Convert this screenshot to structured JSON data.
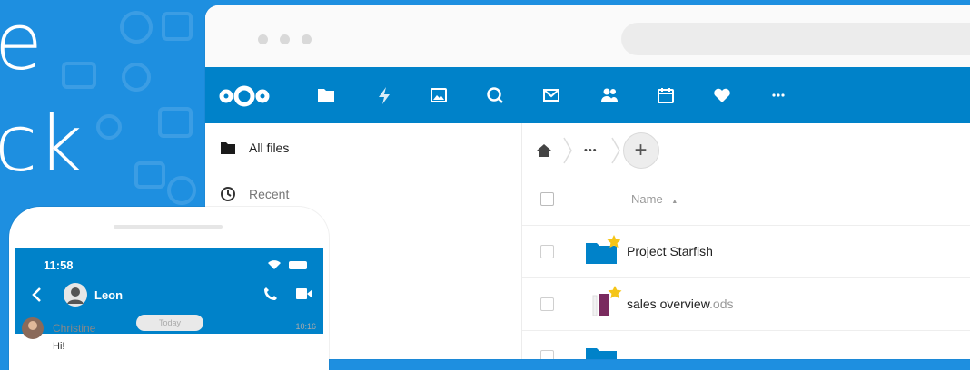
{
  "hero": {
    "line1": "e",
    "line2": "ck"
  },
  "desktop": {
    "nav_icons": [
      "files-icon",
      "activity-icon",
      "photos-icon",
      "search-icon",
      "mail-icon",
      "contacts-icon",
      "calendar-icon",
      "favorites-icon",
      "more-icon"
    ],
    "sidebar": {
      "items": [
        {
          "label": "All files",
          "icon": "folder-icon"
        },
        {
          "label": "Recent",
          "icon": "clock-icon"
        }
      ]
    },
    "breadcrumb": {
      "home_icon": "home-icon",
      "more": "•••",
      "add": "+"
    },
    "table": {
      "name_header": "Name",
      "sort_indicator": "▲",
      "rows": [
        {
          "name": "Project Starfish",
          "ext": "",
          "type": "folder",
          "favorite": true
        },
        {
          "name": "sales overview",
          "ext": ".ods",
          "type": "spreadsheet",
          "favorite": true
        }
      ]
    }
  },
  "phone": {
    "time": "11:58",
    "contact": "Leon",
    "chat": {
      "author": "Christine",
      "date_chip": "Today",
      "timestamp": "10:16",
      "message": "Hi!"
    }
  },
  "colors": {
    "brand_blue": "#0082c9",
    "background_blue": "#1e8fe0",
    "star": "#f5c518"
  }
}
